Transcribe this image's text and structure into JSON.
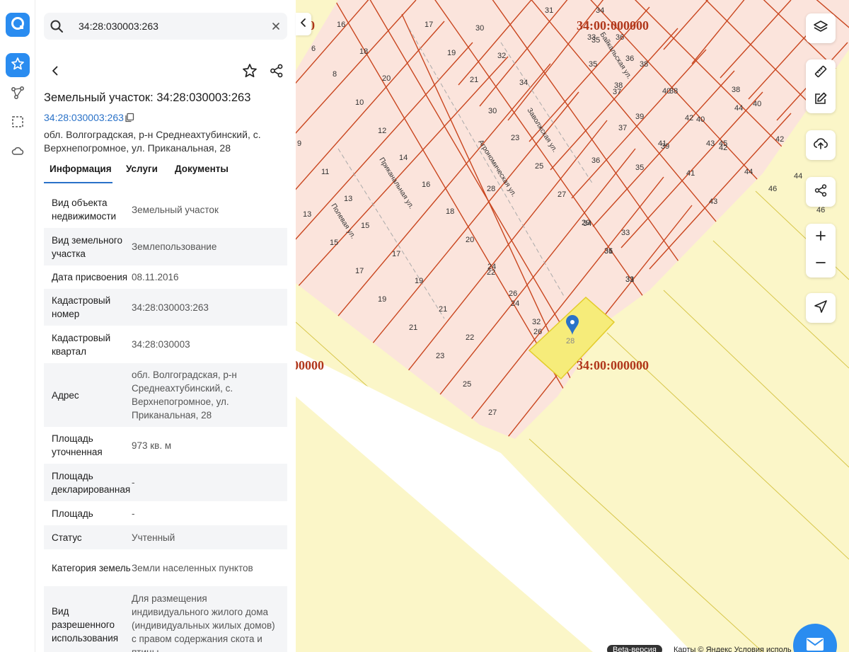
{
  "search": {
    "value": "34:28:030003:263"
  },
  "object": {
    "title": "Земельный участок: 34:28:030003:263",
    "cadastral_link": "34:28:030003:263",
    "address": "обл. Волгоградская, р-н Среднеахтубинский, с. Верхнепогромное, ул. Приканальная, 28"
  },
  "tabs": [
    "Информация",
    "Услуги",
    "Документы"
  ],
  "info_rows": [
    {
      "key": "Вид объекта недвижимости",
      "value": "Земельный участок"
    },
    {
      "key": "Вид земельного участка",
      "value": "Землепользование"
    },
    {
      "key": "Дата присвоения",
      "value": "08.11.2016"
    },
    {
      "key": "Кадастровый номер",
      "value": "34:28:030003:263"
    },
    {
      "key": "Кадастровый квартал",
      "value": "34:28:030003"
    },
    {
      "key": "Адрес",
      "value": "обл. Волгоградская, р-н Среднеахтубинский, с. Верхнепогромное, ул. Приканальная, 28"
    },
    {
      "key": "Площадь уточненная",
      "value": "973 кв. м"
    },
    {
      "key": "Площадь декларированная",
      "value": "-"
    },
    {
      "key": "Площадь",
      "value": "-"
    },
    {
      "key": "Статус",
      "value": "Учтенный"
    },
    {
      "key": "Категория земель",
      "value": "Земли населенных пунктов"
    },
    {
      "key": "Вид разрешенного использования",
      "value": "Для размещения индивидуального жилого дома (индивидуальных жилых домов) с правом содержания скота и птицы"
    }
  ],
  "map": {
    "zone_labels": [
      "34:00:000000",
      "34:00:000000",
      ":000000",
      "0"
    ],
    "streets": [
      "Байкальская ул.",
      "Заволжская ул.",
      "Агрономическая ул.",
      "Приканальная ул.",
      "Полевая ул."
    ],
    "selected_parcel": "28",
    "parcels_block_a": [
      "16",
      "17",
      "30",
      "18",
      "19",
      "32",
      "20",
      "21",
      "34",
      "6",
      "8",
      "10",
      "12",
      "14",
      "16",
      "18",
      "20",
      "22",
      "24",
      "26",
      "28",
      "30",
      "23",
      "25",
      "27",
      "29",
      "31",
      "33",
      "35",
      "36",
      "38",
      "40",
      "42",
      "44",
      "46"
    ],
    "parcels_block_b": [
      "11",
      "13",
      "15",
      "17",
      "19",
      "21",
      "23",
      "25",
      "27",
      "13",
      "15",
      "17",
      "19",
      "21",
      "22",
      "24",
      "26",
      "32",
      "34",
      "36",
      "31",
      "33",
      "35",
      "37",
      "39",
      "41",
      "43",
      "45",
      "38",
      "40",
      "42",
      "44",
      "46"
    ],
    "parcels_block_c": [
      "31",
      "34",
      "35",
      "36",
      "37",
      "38",
      "39",
      "40",
      "41",
      "42",
      "43",
      "44",
      "33",
      "36",
      "38",
      "9"
    ],
    "beta_label": "Beta-версия",
    "attribution": "Карты © Яндекс   Условия исполь"
  },
  "colors": {
    "accent": "#2a8cf0",
    "link": "#2a72c8",
    "parcel_fill": "#fbe4dc",
    "parcel_stroke": "#c9461f",
    "zone_fill": "#fbf6c8",
    "zone_stroke": "#d7c64a",
    "selected_fill": "#f6ec7a",
    "label_red": "#b0361a"
  },
  "icons": [
    "logo-icon",
    "star-icon",
    "route-icon",
    "selection-icon",
    "cloud-icon",
    "search-icon",
    "clear-icon",
    "back-icon",
    "favorite-icon",
    "share-icon",
    "copy-icon",
    "layers-icon",
    "ruler-icon",
    "edit-icon",
    "upload-icon",
    "share-map-icon",
    "zoom-in-icon",
    "zoom-out-icon",
    "locate-icon",
    "chevron-left-icon",
    "map-pin-icon",
    "mail-icon"
  ]
}
